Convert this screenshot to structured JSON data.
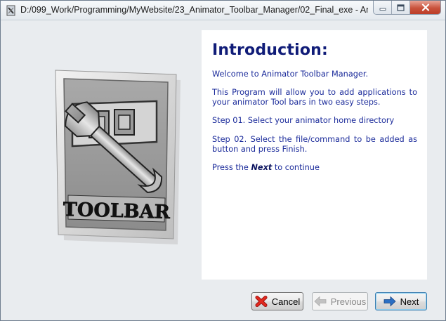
{
  "window": {
    "title": "D:/099_Work/Programming/MyWebsite/23_Animator_Toolbar_Manager/02_Final_exe - Ani..."
  },
  "illustration": {
    "label": "TOOLBAR"
  },
  "intro": {
    "heading": "Introduction:",
    "welcome": "Welcome to Animator Toolbar Manager.",
    "description": "This Program will allow you to add applications to your animator Tool bars in two easy steps.",
    "step1": "Step 01. Select your animator home directory",
    "step2": "Step 02. Select the file/command to be added as button and press Finish.",
    "continue_prefix": "Press the ",
    "continue_emphasis": "Next",
    "continue_suffix": " to continue"
  },
  "buttons": {
    "cancel": "Cancel",
    "previous": "Previous",
    "next": "Next"
  },
  "colors": {
    "heading": "#101c78",
    "body_text": "#1a2a9a",
    "window_bg": "#e9ecef"
  },
  "icons": {
    "cancel": "red-x-icon",
    "previous": "arrow-left-icon",
    "next": "arrow-right-icon",
    "app": "application-icon"
  }
}
